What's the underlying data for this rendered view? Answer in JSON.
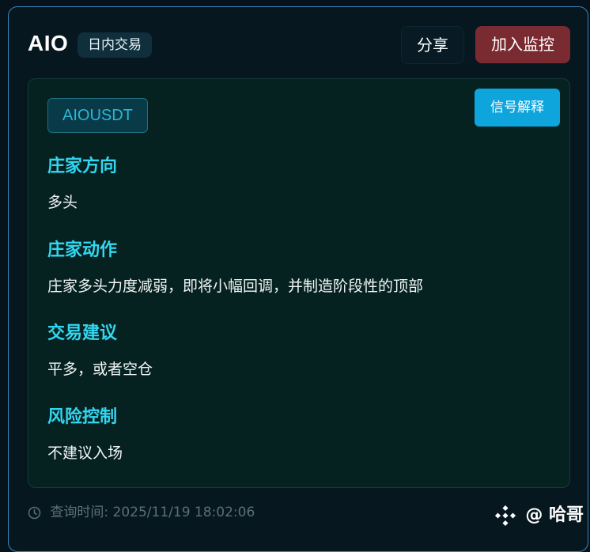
{
  "header": {
    "title": "AIO",
    "tag": "日内交易",
    "share_label": "分享",
    "monitor_label": "加入监控"
  },
  "panel": {
    "symbol": "AIOUSDT",
    "explain_label": "信号解释",
    "sections": [
      {
        "title": "庄家方向",
        "body": "多头"
      },
      {
        "title": "庄家动作",
        "body": "庄家多头力度减弱，即将小幅回调，并制造阶段性的顶部"
      },
      {
        "title": "交易建议",
        "body": "平多，或者空仓"
      },
      {
        "title": "风险控制",
        "body": "不建议入场"
      }
    ]
  },
  "footer": {
    "query_time": "查询时间: 2025/11/19 18:02:06",
    "clock_icon": "clock-icon"
  },
  "watermark": {
    "text": "@ 哈哥",
    "logo_icon": "diamond-logo-icon"
  },
  "colors": {
    "accent_cyan": "#33d6f0",
    "monitor_button": "#7a2a31",
    "explain_button": "#0ea5dd",
    "card_border": "#3a86b8"
  }
}
